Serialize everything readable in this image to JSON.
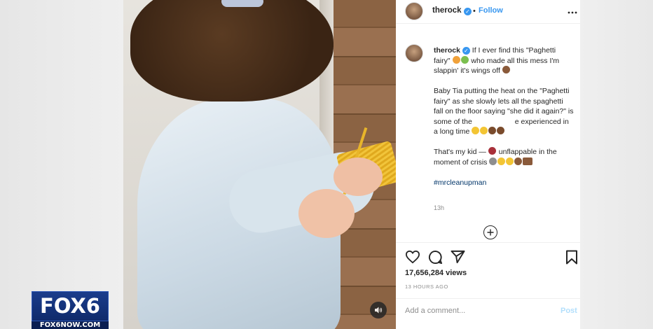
{
  "post": {
    "username": "therock",
    "follow_label": "Follow",
    "follow_separator": "•",
    "more_label": "•••",
    "caption_user": "therock",
    "caption_p1_a": "If I ever find this \"Paghetti fairy\"",
    "caption_p1_b": "who made all this mess I'm slappin' it's wings off",
    "caption_p2_a": "Baby Tia putting the heat on the \"Paghetti fairy\" as she slowly lets all the spaghetti fall on the floor saying \"she did it again?\" is some of the",
    "caption_p2_b": "e experienced in a long time",
    "caption_p3_a": "That's my kid —",
    "caption_p3_b": "unflappable in the moment of crisis",
    "hashtag": "#mrcleanupman",
    "time": "13h",
    "views": "17,656,284 views",
    "posted_ago": "13 HOURS AGO",
    "comment_placeholder": "Add a comment...",
    "post_label": "Post"
  },
  "station": {
    "logo_text": "FOX6",
    "url_text": "FOX6NOW.COM"
  },
  "icons": [
    "verified-badge-icon",
    "heart-icon",
    "comment-icon",
    "share-icon",
    "bookmark-icon",
    "plus-circle-icon",
    "sound-icon"
  ],
  "colors": {
    "link": "#3897f0",
    "hashtag": "#003569",
    "fox_blue": "#1b3d8c"
  }
}
